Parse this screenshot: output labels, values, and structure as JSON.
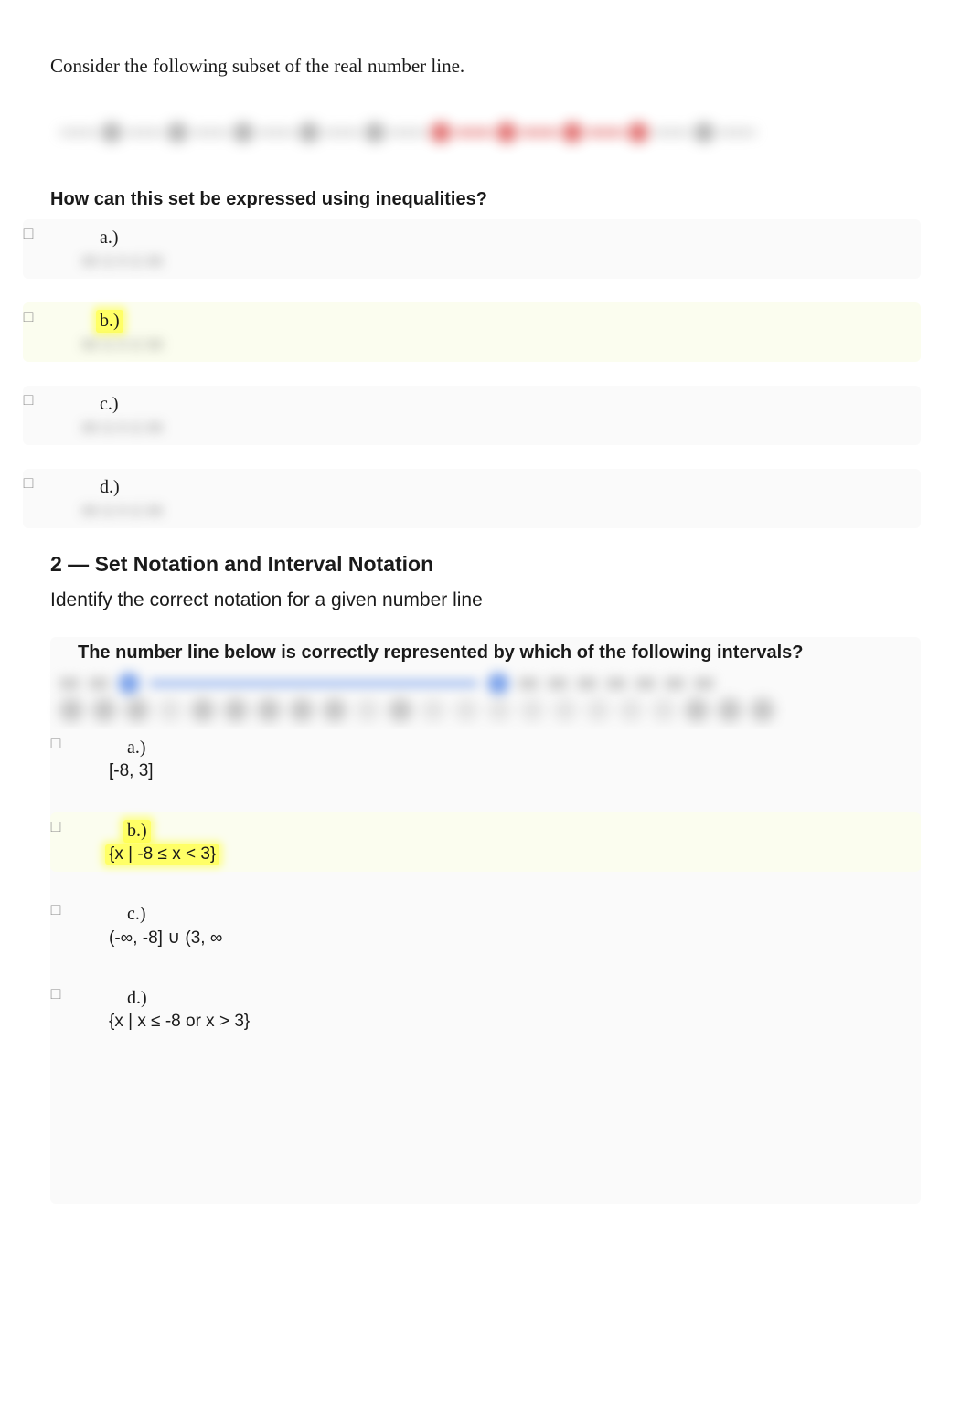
{
  "q1": {
    "intro": "Consider the following subset of the real number line.",
    "prompt": "How can this set be expressed using inequalities?",
    "options": [
      {
        "label": "a.)",
        "answer": "[blurred]",
        "correct": false
      },
      {
        "label": "b.)",
        "answer": "[blurred]",
        "correct": true
      },
      {
        "label": "c.)",
        "answer": "[blurred]",
        "correct": false
      },
      {
        "label": "d.)",
        "answer": "[blurred]",
        "correct": false
      }
    ]
  },
  "section": {
    "heading": "2 — Set Notation and Interval Notation",
    "desc": "Identify the correct notation for a given number line"
  },
  "q2": {
    "prompt": "The number line below is correctly represented by which of the following intervals?",
    "options": [
      {
        "label": "a.)",
        "answer": "[-8, 3]",
        "correct": false
      },
      {
        "label": "b.)",
        "answer": "{x | -8 ≤ x < 3}",
        "correct": true
      },
      {
        "label": "c.)",
        "answer": "(-∞, -8] ∪ (3, ∞",
        "correct": false
      },
      {
        "label": "d.)",
        "answer": "{x | x ≤ -8 or x > 3}",
        "correct": false
      }
    ]
  }
}
